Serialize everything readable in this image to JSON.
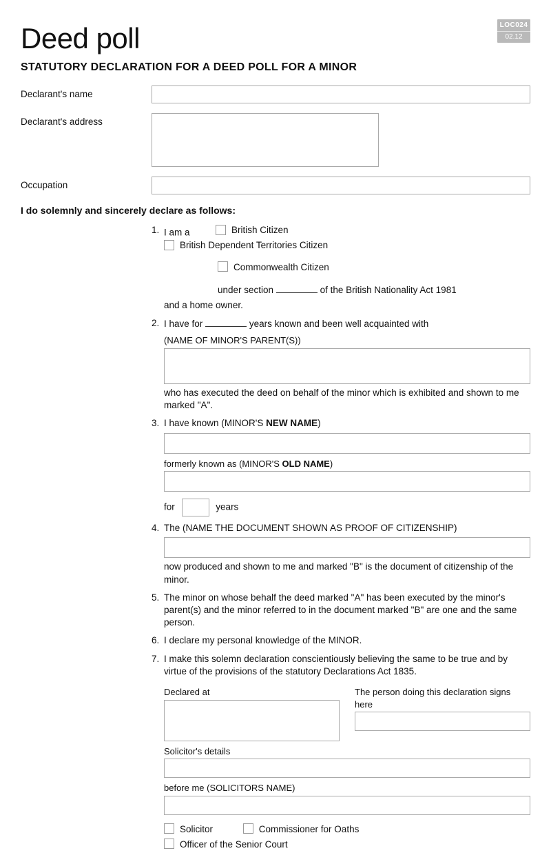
{
  "badge": {
    "code": "LOC024",
    "rev": "02.12"
  },
  "title": "Deed poll",
  "subtitle": "STATUTORY DECLARATION FOR A DEED POLL FOR A MINOR",
  "labels": {
    "declarant_name": "Declarant's name",
    "declarant_address": "Declarant's address",
    "occupation": "Occupation"
  },
  "declare_heading": "I do solemnly and sincerely declare as follows:",
  "c1": {
    "lead": "I am a",
    "opt_british": "British Citizen",
    "opt_bdtc": "British Dependent Territories Citizen",
    "opt_cw": "Commonwealth Citizen",
    "under_pre": "under section",
    "under_post": "of the British Nationality Act 1981",
    "homeowner": "and a home owner."
  },
  "c2": {
    "pre": "I have for",
    "post": "years known and been well acquainted with",
    "caption": "(NAME OF MINOR'S PARENT(S))",
    "after": "who has executed the deed on behalf of the minor which is exhibited and shown to me marked \"A\"."
  },
  "c3": {
    "lead_pre": "I have known (MINOR'S ",
    "lead_bold": "NEW NAME",
    "lead_post": ")",
    "formerly_pre": "formerly known as (MINOR'S ",
    "formerly_bold": "OLD NAME",
    "formerly_post": ")",
    "for": "for",
    "years": "years"
  },
  "c4": {
    "lead": "The (NAME THE DOCUMENT SHOWN AS PROOF OF CITIZENSHIP)",
    "after": "now produced and shown to me and marked \"B\" is the document of citizenship of the minor."
  },
  "c5": "The minor on whose behalf the deed marked \"A\" has been executed by the minor's parent(s) and the minor referred to in the document marked \"B\" are one and the same person.",
  "c6": "I declare my personal knowledge of the MINOR.",
  "c7": " I make this solemn declaration conscientiously believing the same to be true and by virtue of the provisions of the statutory Declarations Act 1835.",
  "sig": {
    "declared_at": "Declared at",
    "signer": "The person doing this declaration signs here",
    "solicitor_details": "Solicitor's details",
    "before_me": "before me (SOLICITORS NAME)"
  },
  "role": {
    "solicitor": "Solicitor",
    "commissioner": "Commissioner for Oaths",
    "officer": "Officer of the Senior Court"
  }
}
